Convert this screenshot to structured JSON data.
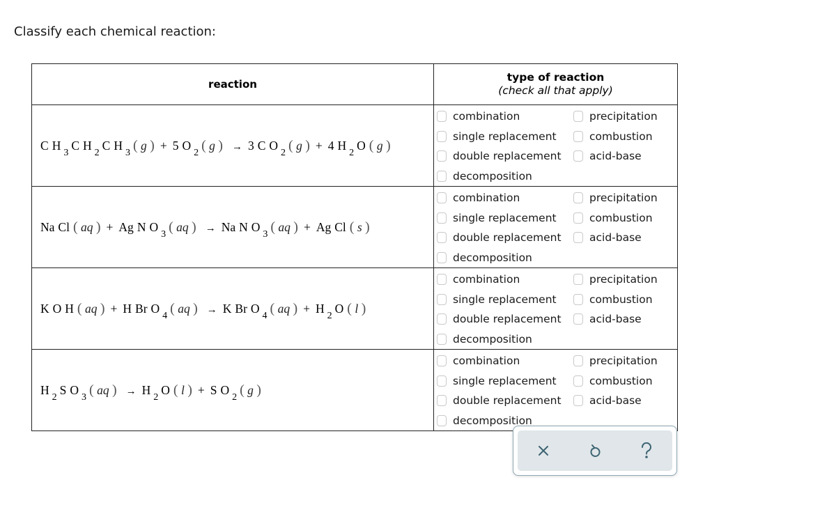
{
  "prompt": "Classify each chemical reaction:",
  "table": {
    "header_reaction": "reaction",
    "header_type_title": "type of reaction",
    "header_type_subtitle": "(check all that apply)"
  },
  "options_left": [
    "combination",
    "single replacement",
    "double replacement",
    "decomposition"
  ],
  "options_right": [
    "precipitation",
    "combustion",
    "acid-base"
  ],
  "reactions": [
    {
      "equation": "CH3CH2CH3(g) + 5O2(g) → 3CO2(g) + 4H2O(g)",
      "tokens": [
        {
          "t": "el",
          "v": "C"
        },
        {
          "t": "el",
          "v": "H"
        },
        {
          "t": "sub",
          "v": "3"
        },
        {
          "t": "el",
          "v": "C"
        },
        {
          "t": "el",
          "v": "H"
        },
        {
          "t": "sub",
          "v": "2"
        },
        {
          "t": "el",
          "v": "C"
        },
        {
          "t": "el",
          "v": "H"
        },
        {
          "t": "sub",
          "v": "3"
        },
        {
          "t": "state",
          "v": "g"
        },
        {
          "t": "op",
          "v": "+"
        },
        {
          "t": "el",
          "v": "5"
        },
        {
          "t": "el",
          "v": "O"
        },
        {
          "t": "sub",
          "v": "2"
        },
        {
          "t": "state",
          "v": "g"
        },
        {
          "t": "arrow",
          "v": "→"
        },
        {
          "t": "el",
          "v": "3"
        },
        {
          "t": "el",
          "v": "C"
        },
        {
          "t": "el",
          "v": "O"
        },
        {
          "t": "sub",
          "v": "2"
        },
        {
          "t": "state",
          "v": "g"
        },
        {
          "t": "op",
          "v": "+"
        },
        {
          "t": "el",
          "v": "4"
        },
        {
          "t": "el",
          "v": "H"
        },
        {
          "t": "sub",
          "v": "2"
        },
        {
          "t": "el",
          "v": "O"
        },
        {
          "t": "state",
          "v": "g"
        }
      ],
      "checked": {
        "combination": false,
        "single replacement": false,
        "double replacement": false,
        "decomposition": false,
        "precipitation": false,
        "combustion": false,
        "acid-base": false
      }
    },
    {
      "equation": "NaCl(aq) + AgNO3(aq) → NaNO3(aq) + AgCl(s)",
      "tokens": [
        {
          "t": "el",
          "v": "Na"
        },
        {
          "t": "el",
          "v": "Cl"
        },
        {
          "t": "state",
          "v": "aq"
        },
        {
          "t": "op",
          "v": "+"
        },
        {
          "t": "el",
          "v": "Ag"
        },
        {
          "t": "el",
          "v": "N"
        },
        {
          "t": "el",
          "v": "O"
        },
        {
          "t": "sub",
          "v": "3"
        },
        {
          "t": "state",
          "v": "aq"
        },
        {
          "t": "arrow",
          "v": "→"
        },
        {
          "t": "el",
          "v": "Na"
        },
        {
          "t": "el",
          "v": "N"
        },
        {
          "t": "el",
          "v": "O"
        },
        {
          "t": "sub",
          "v": "3"
        },
        {
          "t": "state",
          "v": "aq"
        },
        {
          "t": "op",
          "v": "+"
        },
        {
          "t": "el",
          "v": "Ag"
        },
        {
          "t": "el",
          "v": "Cl"
        },
        {
          "t": "state",
          "v": "s"
        }
      ],
      "checked": {
        "combination": false,
        "single replacement": false,
        "double replacement": false,
        "decomposition": false,
        "precipitation": false,
        "combustion": false,
        "acid-base": false
      }
    },
    {
      "equation": "KOH(aq) + HBrO4(aq) → KBrO4(aq) + H2O(l)",
      "tokens": [
        {
          "t": "el",
          "v": "K"
        },
        {
          "t": "el",
          "v": "O"
        },
        {
          "t": "el",
          "v": "H"
        },
        {
          "t": "state",
          "v": "aq"
        },
        {
          "t": "op",
          "v": "+"
        },
        {
          "t": "el",
          "v": "H"
        },
        {
          "t": "el",
          "v": "Br"
        },
        {
          "t": "el",
          "v": "O"
        },
        {
          "t": "sub",
          "v": "4"
        },
        {
          "t": "state",
          "v": "aq"
        },
        {
          "t": "arrow",
          "v": "→"
        },
        {
          "t": "el",
          "v": "K"
        },
        {
          "t": "el",
          "v": "Br"
        },
        {
          "t": "el",
          "v": "O"
        },
        {
          "t": "sub",
          "v": "4"
        },
        {
          "t": "state",
          "v": "aq"
        },
        {
          "t": "op",
          "v": "+"
        },
        {
          "t": "el",
          "v": "H"
        },
        {
          "t": "sub",
          "v": "2"
        },
        {
          "t": "el",
          "v": "O"
        },
        {
          "t": "state",
          "v": "l"
        }
      ],
      "checked": {
        "combination": false,
        "single replacement": false,
        "double replacement": false,
        "decomposition": false,
        "precipitation": false,
        "combustion": false,
        "acid-base": false
      }
    },
    {
      "equation": "H2SO3(aq) → H2O(l) + SO2(g)",
      "tokens": [
        {
          "t": "el",
          "v": "H"
        },
        {
          "t": "sub",
          "v": "2"
        },
        {
          "t": "el",
          "v": "S"
        },
        {
          "t": "el",
          "v": "O"
        },
        {
          "t": "sub",
          "v": "3"
        },
        {
          "t": "state",
          "v": "aq"
        },
        {
          "t": "arrow",
          "v": "→"
        },
        {
          "t": "el",
          "v": "H"
        },
        {
          "t": "sub",
          "v": "2"
        },
        {
          "t": "el",
          "v": "O"
        },
        {
          "t": "state",
          "v": "l"
        },
        {
          "t": "op",
          "v": "+"
        },
        {
          "t": "el",
          "v": "S"
        },
        {
          "t": "el",
          "v": "O"
        },
        {
          "t": "sub",
          "v": "2"
        },
        {
          "t": "state",
          "v": "g"
        }
      ],
      "checked": {
        "combination": false,
        "single replacement": false,
        "double replacement": false,
        "decomposition": false,
        "precipitation": false,
        "combustion": false,
        "acid-base": false
      }
    }
  ],
  "toolbar": {
    "clear_icon": "x-icon",
    "undo_icon": "undo-icon",
    "help_icon": "help-icon",
    "border_color": "#8fa7b3",
    "fill_color": "#e0e6e9",
    "icon_color": "#3d6473"
  }
}
